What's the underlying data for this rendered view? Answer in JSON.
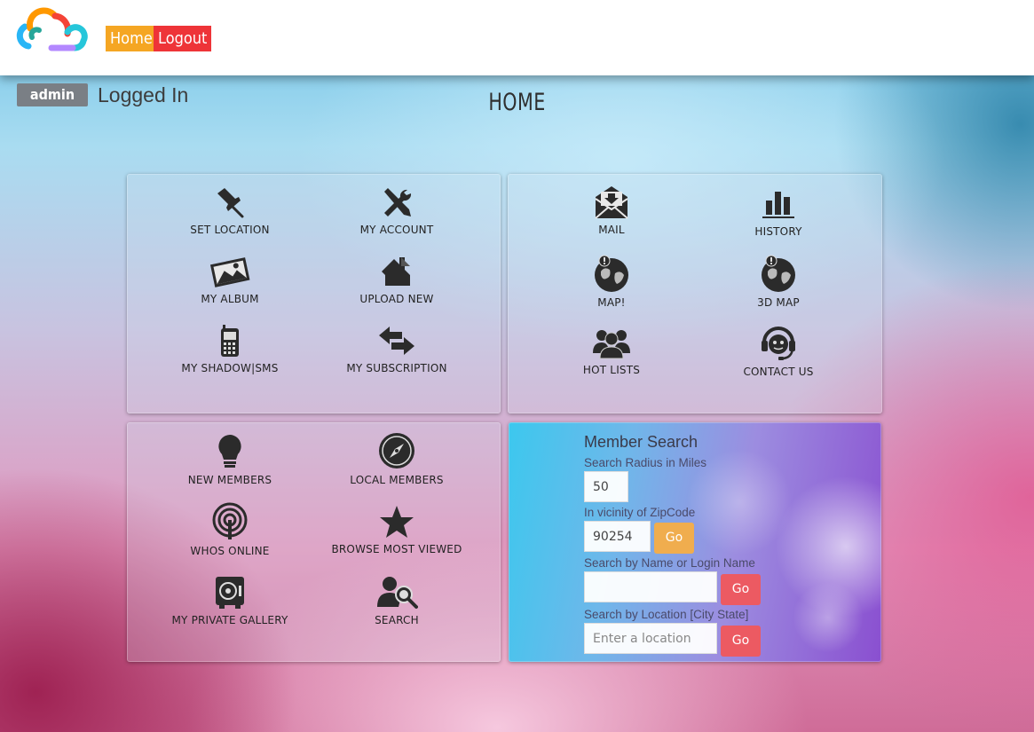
{
  "header": {
    "home_label": "Home",
    "logout_label": "Logout"
  },
  "user": {
    "name": "admin",
    "status": "Logged In"
  },
  "page": {
    "title": "HOME"
  },
  "panel_account": {
    "tiles": [
      {
        "label": "SET LOCATION",
        "icon": "pin-icon"
      },
      {
        "label": "MY ACCOUNT",
        "icon": "tools-icon"
      },
      {
        "label": "MY ALBUM",
        "icon": "photos-icon"
      },
      {
        "label": "UPLOAD NEW",
        "icon": "upload-house-icon"
      },
      {
        "label": "MY SHADOW|SMS",
        "icon": "mobile-phone-icon"
      },
      {
        "label": "MY SUBSCRIPTION",
        "icon": "exchange-arrows-icon"
      }
    ]
  },
  "panel_communication": {
    "tiles": [
      {
        "label": "MAIL",
        "icon": "mail-icon"
      },
      {
        "label": "HISTORY",
        "icon": "bar-chart-icon"
      },
      {
        "label": "MAP!",
        "icon": "globe-pin-icon"
      },
      {
        "label": "3D MAP",
        "icon": "globe-pin-3d-icon"
      },
      {
        "label": "HOT LISTS",
        "icon": "group-icon"
      },
      {
        "label": "CONTACT US",
        "icon": "headset-icon"
      }
    ]
  },
  "panel_members": {
    "tiles": [
      {
        "label": "NEW MEMBERS",
        "icon": "lightbulb-icon"
      },
      {
        "label": "LOCAL MEMBERS",
        "icon": "compass-icon"
      },
      {
        "label": "WHOS ONLINE",
        "icon": "broadcast-icon"
      },
      {
        "label": "BROWSE MOST VIEWED",
        "icon": "star-icon"
      },
      {
        "label": "MY PRIVATE GALLERY",
        "icon": "safe-icon"
      },
      {
        "label": "SEARCH",
        "icon": "user-search-icon"
      }
    ]
  },
  "member_search": {
    "title": "Member Search",
    "radius_label": "Search Radius in Miles",
    "radius_value": "50",
    "zip_label": "In vicinity of ZipCode",
    "zip_value": "90254",
    "name_label": "Search by Name or Login Name",
    "name_value": "",
    "location_label": "Search by Location [City State]",
    "location_placeholder": "Enter a location",
    "go_label": "Go"
  },
  "colors": {
    "home_button": "#f5a623",
    "logout_button": "#ee3438",
    "go_yellow": "#f0ad4e",
    "go_red": "#ec5a62"
  }
}
